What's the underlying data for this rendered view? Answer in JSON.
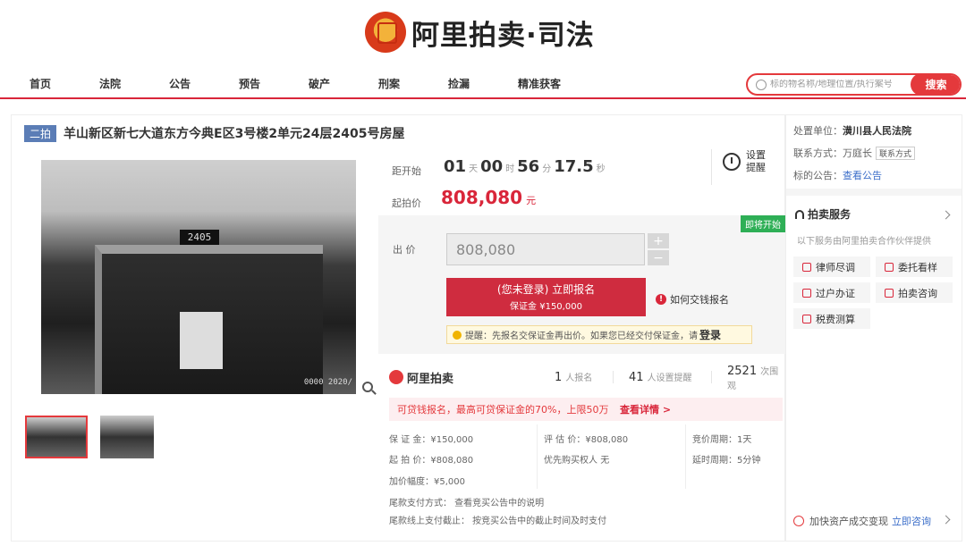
{
  "brand": {
    "name": "阿里拍卖·司法"
  },
  "nav": {
    "items": [
      "首页",
      "法院",
      "公告",
      "预告",
      "破产",
      "刑案",
      "捡漏",
      "精准获客"
    ],
    "search_placeholder": "标的物名称/地理位置/执行案号",
    "search_label": "搜索"
  },
  "item": {
    "tag": "二拍",
    "title": "羊山新区新七大道东方今典E区3号楼2单元24层2405号房屋",
    "photo_plate": "2405",
    "photo_watermark": "0000 2020/"
  },
  "auction": {
    "countdown_label": "距开始",
    "countdown": {
      "days": "01",
      "days_unit": "天",
      "hours": "00",
      "hours_unit": "时",
      "minutes": "56",
      "minutes_unit": "分",
      "seconds": "17.5",
      "seconds_unit": "秒"
    },
    "remind_label": "设置提醒",
    "start_price_label": "起拍价",
    "start_price": "808,080",
    "price_unit": "元",
    "soon_badge": "即将开始",
    "bid_label": "出 价",
    "bid_value": "808,080",
    "plus": "+",
    "minus": "−",
    "signup_line1": "(您未登录) 立即报名",
    "signup_line2": "保证金 ¥150,000",
    "how_pay": "如何交钱报名",
    "info_mark": "!",
    "tip_text": "提醒：先报名交保证金再出价。如果您已经交付保证金，请",
    "tip_login": "登录"
  },
  "stats": {
    "logo": "阿里拍卖",
    "signups": "1",
    "signups_label": "人报名",
    "reminders": "41",
    "reminders_label": "人设置提醒",
    "views": "2521",
    "views_label": "次围观"
  },
  "loan": {
    "text": "可贷钱报名，最高可贷保证金的70%，上限50万",
    "link": "查看详情 >"
  },
  "details": {
    "deposit": "保 证 金：¥150,000",
    "start": "起 拍 价：¥808,080",
    "increment": "加价幅度：¥5,000",
    "appraisal": "评 估 价：¥808,080",
    "priority": "优先购买权人",
    "priority_value": "无",
    "period": "竞价周期：1天",
    "delay": "延时周期：5分钟",
    "payment": "尾款支付方式：   查看竞买公告中的说明",
    "deadline": "尾款线上支付截止：   按竞买公告中的截止时间及时支付"
  },
  "side": {
    "court_label": "处置单位：",
    "court": "潢川县人民法院",
    "contact_label": "联系方式：",
    "contact_name": "万庭长",
    "contact_tag": "联系方式",
    "notice_label": "标的公告：",
    "notice_link": "查看公告",
    "service_title": "拍卖服务",
    "service_sub": "以下服务由阿里拍卖合作伙伴提供",
    "services": [
      "律师尽调",
      "委托看样",
      "过户办证",
      "拍卖咨询",
      "税费测算"
    ],
    "footer_text": "加快资产成交变现",
    "footer_link": "立即咨询"
  },
  "colors": {
    "accent": "#d9263a",
    "badge": "#2eaf56",
    "tag": "#5b7db6",
    "link": "#3b6ec9"
  }
}
